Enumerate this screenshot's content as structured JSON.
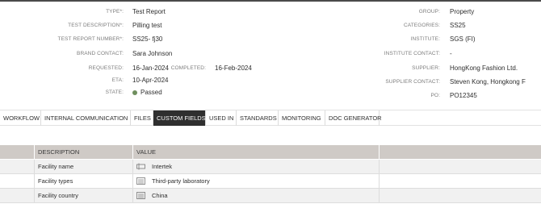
{
  "left_fields": [
    {
      "label": "TYPE*:",
      "value": "Test Report"
    },
    {
      "label": "TEST DESCRIPTION*:",
      "value": "Pilling test"
    },
    {
      "label": "TEST REPORT NUMBER*:",
      "value": "SS25- fj30"
    },
    {
      "label": "BRAND CONTACT:",
      "value": "Sara Johnson"
    },
    {
      "label": "REQUESTED:",
      "value": "16-Jan-2024"
    },
    {
      "label": "ETA:",
      "value": "10-Apr-2024"
    },
    {
      "label": "STATE:",
      "value": "Passed"
    }
  ],
  "completed": {
    "label": "COMPLETED:",
    "value": "16-Feb-2024"
  },
  "right_fields": [
    {
      "label": "GROUP:",
      "value": "Property"
    },
    {
      "label": "CATEGORIES:",
      "value": "SS25"
    },
    {
      "label": "INSTITUTE:",
      "value": "SGS (FI)"
    },
    {
      "label": "INSTITUTE CONTACT:",
      "value": "-"
    },
    {
      "label": "SUPPLIER:",
      "value": "HongKong Fashion Ltd."
    },
    {
      "label": "SUPPLIER CONTACT:",
      "value": "Steven Kong, Hongkong F"
    },
    {
      "label": "PO:",
      "value": "PO12345"
    }
  ],
  "state_color": "#6f8f5e",
  "tabs": [
    {
      "label": "WORKFLOW",
      "active": false
    },
    {
      "label": "INTERNAL COMMUNICATION",
      "active": false
    },
    {
      "label": "FILES",
      "active": false
    },
    {
      "label": "CUSTOM FIELDS",
      "active": true
    },
    {
      "label": "USED IN",
      "active": false
    },
    {
      "label": "STANDARDS",
      "active": false
    },
    {
      "label": "MONITORING",
      "active": false
    },
    {
      "label": "DOC GENERATOR",
      "active": false
    }
  ],
  "table": {
    "headers": [
      "DESCRIPTION",
      "VALUE"
    ],
    "rows": [
      {
        "description": "Facility name",
        "icon": "text-field-icon",
        "value": "Intertek"
      },
      {
        "description": "Facility types",
        "icon": "list-icon",
        "value": "Third-party laboratory"
      },
      {
        "description": "Facility country",
        "icon": "list-icon",
        "value": "China"
      }
    ]
  }
}
